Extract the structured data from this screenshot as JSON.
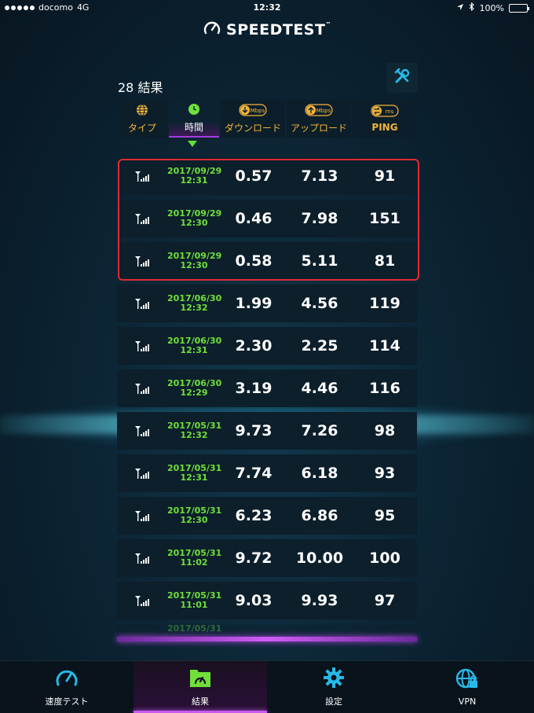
{
  "status": {
    "carrier": "docomo",
    "network": "4G",
    "time": "12:32",
    "battery": "100%"
  },
  "logo": {
    "text": "SPEEDTEST",
    "tm": "™",
    "icon": "speedometer-icon"
  },
  "results_header": {
    "count": "28 結果",
    "tools_icon": "tools-icon"
  },
  "columns": [
    {
      "label": "タイプ",
      "icon": "globe-icon"
    },
    {
      "label": "時間",
      "icon": "clock-icon"
    },
    {
      "label": "ダウンロード",
      "icon": "download-icon",
      "unit": "Mbps"
    },
    {
      "label": "アップロード",
      "icon": "upload-icon",
      "unit": "Mbps"
    },
    {
      "label": "PING",
      "icon": "ping-icon",
      "unit": "ms"
    }
  ],
  "rows": [
    {
      "date": "2017/09/29",
      "time": "12:31",
      "download": "0.57",
      "upload": "7.13",
      "ping": "91"
    },
    {
      "date": "2017/09/29",
      "time": "12:30",
      "download": "0.46",
      "upload": "7.98",
      "ping": "151"
    },
    {
      "date": "2017/09/29",
      "time": "12:30",
      "download": "0.58",
      "upload": "5.11",
      "ping": "81"
    },
    {
      "date": "2017/06/30",
      "time": "12:32",
      "download": "1.99",
      "upload": "4.56",
      "ping": "119"
    },
    {
      "date": "2017/06/30",
      "time": "12:31",
      "download": "2.30",
      "upload": "2.25",
      "ping": "114"
    },
    {
      "date": "2017/06/30",
      "time": "12:29",
      "download": "3.19",
      "upload": "4.46",
      "ping": "116"
    },
    {
      "date": "2017/05/31",
      "time": "12:32",
      "download": "9.73",
      "upload": "7.26",
      "ping": "98"
    },
    {
      "date": "2017/05/31",
      "time": "12:31",
      "download": "7.74",
      "upload": "6.18",
      "ping": "93"
    },
    {
      "date": "2017/05/31",
      "time": "12:30",
      "download": "6.23",
      "upload": "6.86",
      "ping": "95"
    },
    {
      "date": "2017/05/31",
      "time": "11:02",
      "download": "9.72",
      "upload": "10.00",
      "ping": "100"
    },
    {
      "date": "2017/05/31",
      "time": "11:01",
      "download": "9.03",
      "upload": "9.93",
      "ping": "97"
    },
    {
      "date": "2017/05/31",
      "time": "",
      "download": "",
      "upload": "",
      "ping": ""
    }
  ],
  "tabs": [
    {
      "label": "速度テスト",
      "icon": "speedometer-icon"
    },
    {
      "label": "結果",
      "icon": "results-folder-icon"
    },
    {
      "label": "設定",
      "icon": "gear-icon"
    },
    {
      "label": "VPN",
      "icon": "vpn-globe-lock-icon"
    }
  ],
  "colors": {
    "accent_orange": "#f4b43a",
    "date_green": "#6fe03a",
    "highlight_red": "#e02a34",
    "tab_accent": "#c75af0",
    "icon_cyan": "#27b9e8"
  }
}
